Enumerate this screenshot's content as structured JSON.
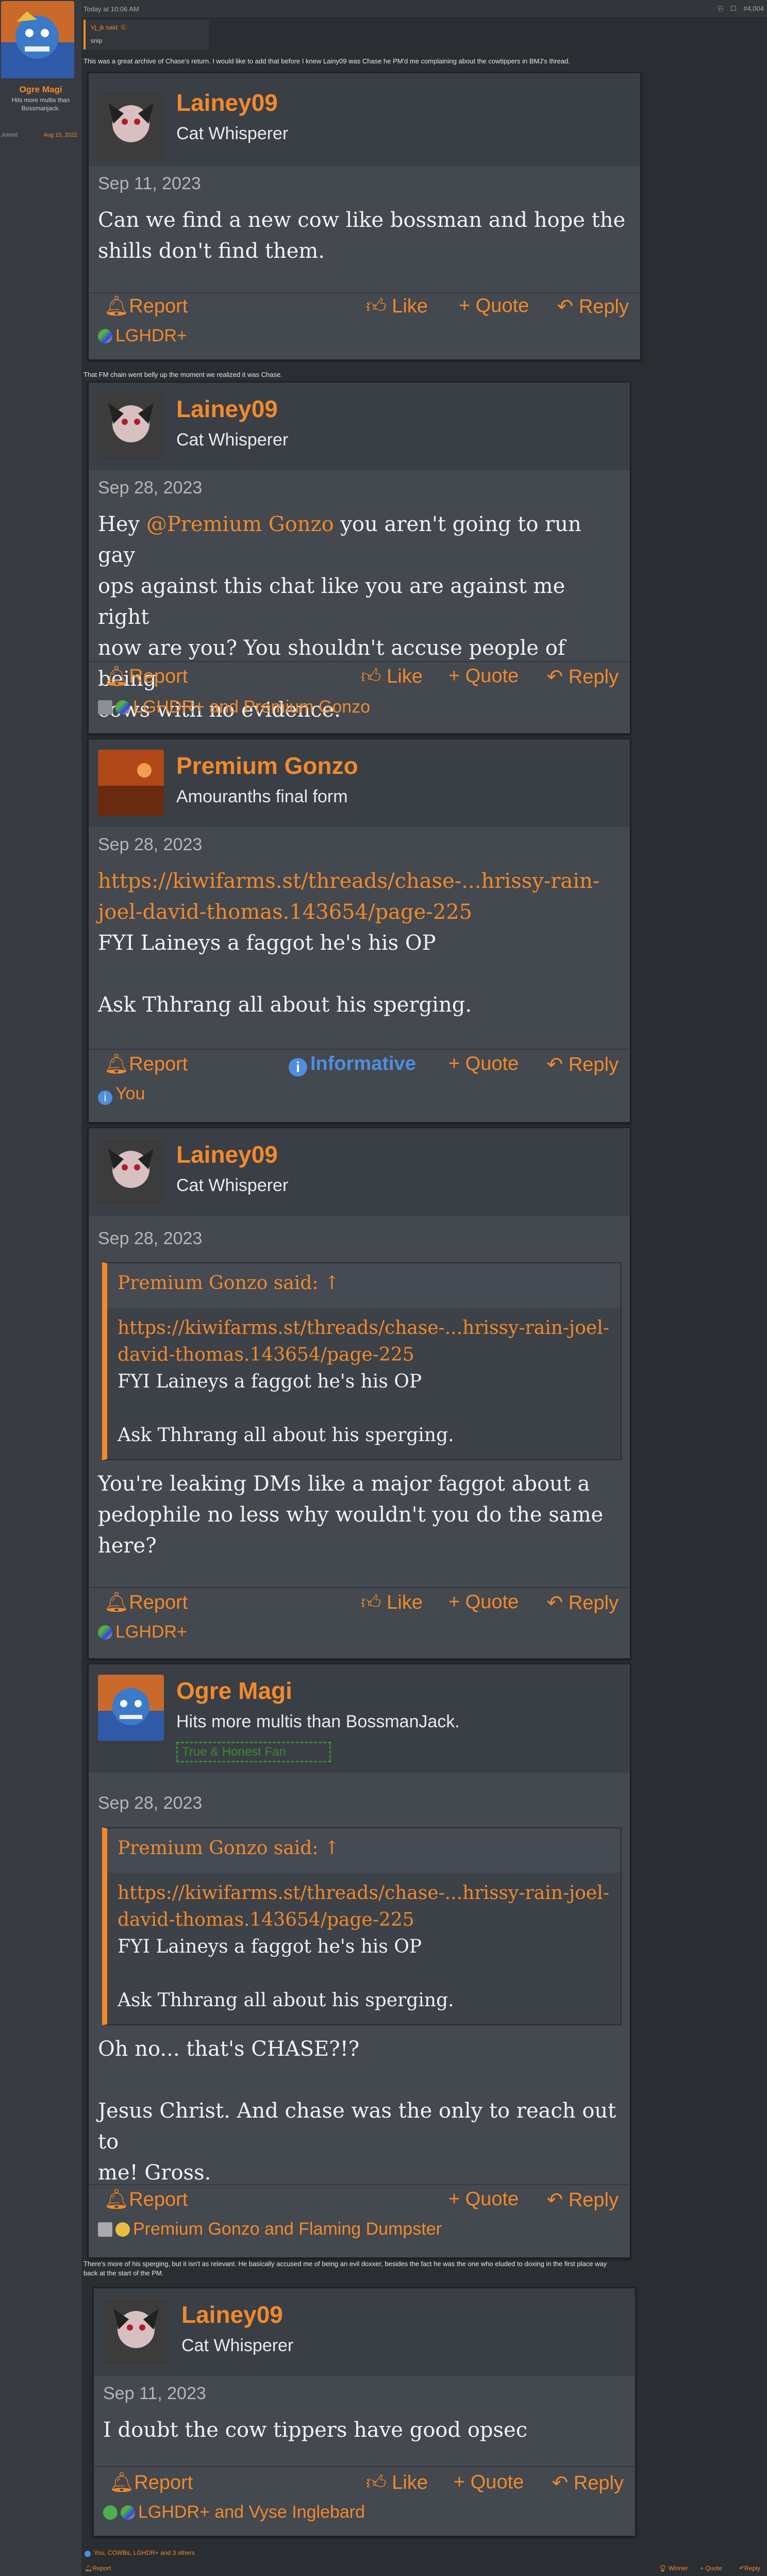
{
  "left_panel": {
    "username": "Ogre Magi",
    "user_title": "Hits more multis than Bossmanjack.",
    "joined_label": "Joined",
    "joined_value": "Aug 15, 2022"
  },
  "post_header": {
    "date": "Today at 10:06 AM",
    "post_number": "#4,004"
  },
  "quote_head": {
    "who": "Vj_jk said: Ⓒ",
    "snip": "snip"
  },
  "intro_text": "This was a great archive of Chase's return. I would like to add that before I knew Lainy09 was Chase he PM'd me complaining about the cowtippers in BMJ's thread.",
  "mid_text": "That FM chain went belly up the moment we realized it was Chase.",
  "end_text_line1": "There's more of his sperging, but it isn't as relevant. He basically accused me of being an evil doxxer, besides the fact he was the one who eluded to doxing in the first place way",
  "end_text_line2": "back at the start of the PM.",
  "cards": {
    "c1": {
      "name": "Lainey09",
      "title": "Cat Whisperer",
      "date": "Sep 11, 2023",
      "msg_l1": "Can we find a new cow like bossman and hope the",
      "msg_l2": "shills don't find them.",
      "report": "Report",
      "like": "Like",
      "quote": "Quote",
      "reply": "Reply",
      "reactions": "LGHDR+"
    },
    "c2": {
      "name": "Lainey09",
      "title": "Cat Whisperer",
      "date": "Sep 28, 2023",
      "msg_pre": "Hey ",
      "mention": "@Premium Gonzo",
      "msg_post1": " you aren't going to run gay",
      "msg_l2": "ops against this chat like you are against me right",
      "msg_l3": "now are you? You shouldn't accuse people of being",
      "msg_l4": "cows with no evidence.",
      "report": "Report",
      "like": "Like",
      "quote": "Quote",
      "reply": "Reply",
      "reactions": "LGHDR+ and Premium Gonzo"
    },
    "c3": {
      "name": "Premium Gonzo",
      "title": "Amouranths final form",
      "date": "Sep 28, 2023",
      "link_l1": "https://kiwifarms.st/threads/chase-...hrissy-rain-",
      "link_l2": "joel-david-thomas.143654/page-225",
      "msg_l1": "FYI Laineys a faggot he's his OP",
      "msg_l2": "Ask Thhrang all about his sperging.",
      "report": "Report",
      "informative": "Informative",
      "quote": "Quote",
      "reply": "Reply",
      "reactions": "You"
    },
    "c4": {
      "name": "Lainey09",
      "title": "Cat Whisperer",
      "date": "Sep 28, 2023",
      "q_head": "Premium Gonzo said: ↑",
      "q_link1": "https://kiwifarms.st/threads/chase-...hrissy-rain-joel-",
      "q_link2": "david-thomas.143654/page-225",
      "q_l1": "FYI Laineys a faggot he's his OP",
      "q_l2": "Ask Thhrang all about his sperging.",
      "msg_l1": "You're leaking DMs like a major faggot about a",
      "msg_l2": "pedophile no less why wouldn't you do the same",
      "msg_l3": "here?",
      "report": "Report",
      "like": "Like",
      "quote": "Quote",
      "reply": "Reply",
      "reactions": "LGHDR+"
    },
    "c5": {
      "name": "Ogre Magi",
      "title": "Hits more multis than BossmanJack.",
      "sig": "True & Honest Fan",
      "date": "Sep 28, 2023",
      "q_head": "Premium Gonzo said: ↑",
      "q_link1": "https://kiwifarms.st/threads/chase-...hrissy-rain-joel-",
      "q_link2": "david-thomas.143654/page-225",
      "q_l1": "FYI Laineys a faggot he's his OP",
      "q_l2": "Ask Thhrang all about his sperging.",
      "msg_l1": "Oh no... that's CHASE?!?",
      "msg_l2": "Jesus Christ. And chase was the only to reach out to",
      "msg_l3": "me! Gross.",
      "report": "Report",
      "quote": "Quote",
      "reply": "Reply",
      "reactions": "Premium Gonzo and Flaming Dumpster"
    },
    "c6": {
      "name": "Lainey09",
      "title": "Cat Whisperer",
      "date": "Sep 11, 2023",
      "msg_l1": "I doubt the cow tippers have good opsec",
      "report": "Report",
      "like": "Like",
      "quote": "Quote",
      "reply": "Reply",
      "reactions": "LGHDR+ and Vyse Inglebard"
    }
  },
  "footer": {
    "reactions": "You, COWBs, LGHDR+ and 3 others",
    "report": "Report",
    "winner": "Winner",
    "quote": "Quote",
    "reply": "Reply"
  },
  "colors": {
    "accent": "#f08a2c",
    "informative": "#4f8fe0"
  }
}
